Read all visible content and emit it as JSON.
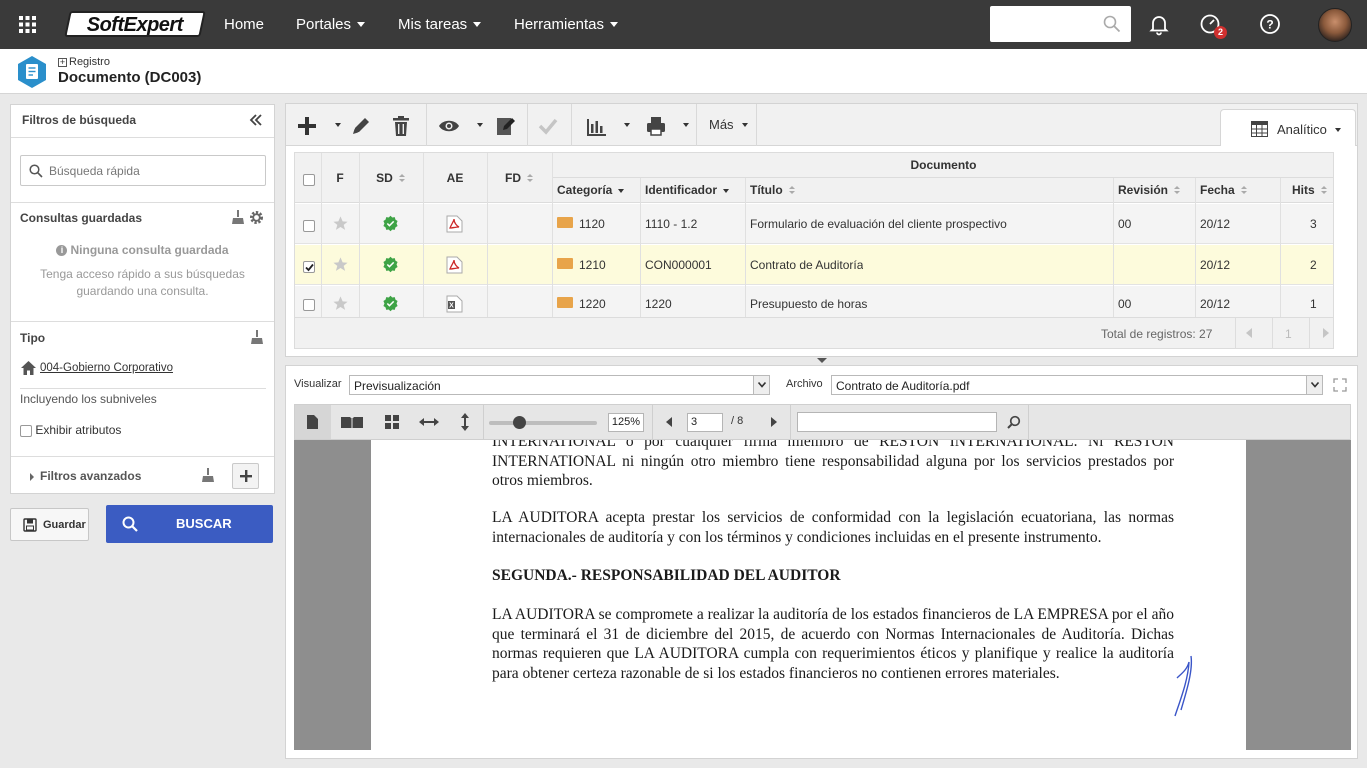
{
  "topbar": {
    "logo": "SoftExpert",
    "nav": [
      {
        "label": "Home"
      },
      {
        "label": "Portales"
      },
      {
        "label": "Mis tareas"
      },
      {
        "label": "Herramientas"
      }
    ],
    "notifications_badge": "2"
  },
  "header": {
    "breadcrumb": "Registro",
    "title": "Documento (DC003)"
  },
  "filters": {
    "title": "Filtros de búsqueda",
    "quick_search_placeholder": "Búsqueda rápida",
    "saved_queries_label": "Consultas guardadas",
    "no_saved_query": "Ninguna consulta guardada",
    "saved_hint": "Tenga acceso rápido a sus búsquedas guardando una consulta.",
    "tipo_label": "Tipo",
    "tipo_value": "004-Gobierno Corporativo",
    "sublevels": "Incluyendo los subniveles",
    "show_attributes": "Exhibir atributos",
    "advanced_filters": "Filtros avanzados",
    "save_button": "Guardar",
    "search_button": "BUSCAR"
  },
  "toolbar": {
    "more_label": "Más",
    "view_mode": "Analítico"
  },
  "grid": {
    "group_header": "Documento",
    "columns": {
      "f": "F",
      "sd": "SD",
      "ae": "AE",
      "fd": "FD",
      "categoria": "Categoría",
      "identificador": "Identificador",
      "titulo": "Título",
      "revision": "Revisión",
      "fecha": "Fecha",
      "hits": "Hits"
    },
    "rows": [
      {
        "categoria": "1120",
        "identificador": "1110 - 1.2",
        "titulo": "Formulario de evaluación del cliente prospectivo",
        "revision": "00",
        "fecha": "20/12",
        "hits": "3",
        "selected": false
      },
      {
        "categoria": "1210",
        "identificador": "CON000001",
        "titulo": "Contrato de Auditoría",
        "revision": "",
        "fecha": "20/12",
        "hits": "2",
        "selected": true
      },
      {
        "categoria": "1220",
        "identificador": "1220",
        "titulo": "Presupuesto de horas",
        "revision": "00",
        "fecha": "20/12",
        "hits": "1",
        "selected": false
      }
    ],
    "total_records": "Total de registros: 27",
    "page": "1"
  },
  "viewer": {
    "visualizar_label": "Visualizar",
    "visualizar_value": "Previsualización",
    "archivo_label": "Archivo",
    "archivo_value": "Contrato de Auditoría.pdf",
    "zoom": "125%",
    "current_page": "3",
    "total_pages": "/ 8",
    "search_value": ""
  },
  "document": {
    "p1": "INTERNATIONAL o por cualquier firma miembro de   RESTON INTERNATIONAL.  Ni RESTON INTERNATIONAL   ni ningún otro miembro tiene responsabilidad alguna por los servicios prestados por otros miembros.",
    "p2": "LA AUDITORA acepta prestar los servicios de conformidad con la legislación ecuatoriana, las normas internacionales de auditoría y con los términos y condiciones incluidas en el presente instrumento.",
    "heading": "SEGUNDA.- RESPONSABILIDAD DEL AUDITOR",
    "p3": "LA AUDITORA se compromete a realizar la auditoría de los estados financieros de LA EMPRESA por el año que terminará el 31 de diciembre del 2015, de acuerdo con Normas Internacionales de Auditoría.  Dichas normas requieren que LA AUDITORA cumpla con requerimientos éticos y planifique y realice la auditoría para obtener certeza razonable de si los estados financieros no contienen errores materiales."
  },
  "colors": {
    "topbar": "#3a3a3a",
    "primary_button": "#3b5cc2",
    "selected_row": "#fdfbdc",
    "ok_green": "#3ea346",
    "pdf_red": "#cc2b2b"
  }
}
